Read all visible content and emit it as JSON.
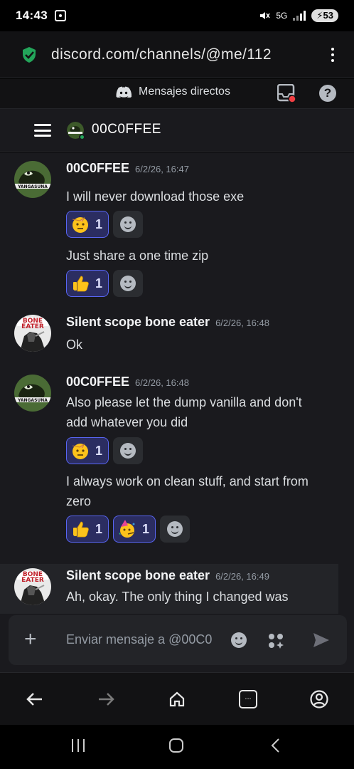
{
  "status_bar": {
    "time": "14:43",
    "network": "5G",
    "battery": "53"
  },
  "browser": {
    "url": "discord.com/channels/@me/112"
  },
  "discord": {
    "dm_label": "Mensajes directos",
    "channel_title": "00C0FFEE",
    "composer_placeholder": "Enviar mensaje a @00C0"
  },
  "messages": [
    {
      "author": "00C0FFEE",
      "timestamp": "6/2/26, 16:47",
      "lines": [
        {
          "text": "I will never download those exe",
          "reactions": [
            {
              "emoji": "saluting-face",
              "count": "1"
            }
          ]
        },
        {
          "text": "Just share a one time zip",
          "reactions": [
            {
              "emoji": "thumbs-up",
              "count": "1"
            }
          ]
        }
      ]
    },
    {
      "author": "Silent scope bone eater",
      "timestamp": "6/2/26, 16:48",
      "lines": [
        {
          "text": "Ok"
        }
      ]
    },
    {
      "author": "00C0FFEE",
      "timestamp": "6/2/26, 16:48",
      "lines": [
        {
          "text": "Also please let the dump vanilla and don't add whatever you did",
          "reactions": [
            {
              "emoji": "saluting-face",
              "count": "1"
            }
          ]
        },
        {
          "text": "I always work on clean stuff, and start from zero",
          "reactions": [
            {
              "emoji": "thumbs-up",
              "count": "1"
            },
            {
              "emoji": "partying-face",
              "count": "1"
            }
          ]
        }
      ]
    },
    {
      "author": "Silent scope bone eater",
      "timestamp": "6/2/26, 16:49",
      "lines": [
        {
          "text": "Ah, okay. The only thing I changed was"
        }
      ]
    }
  ],
  "colors": {
    "accent": "#5865f2",
    "online": "#23a55a",
    "shield": "#23a55a",
    "background": "#1a1a1e"
  }
}
